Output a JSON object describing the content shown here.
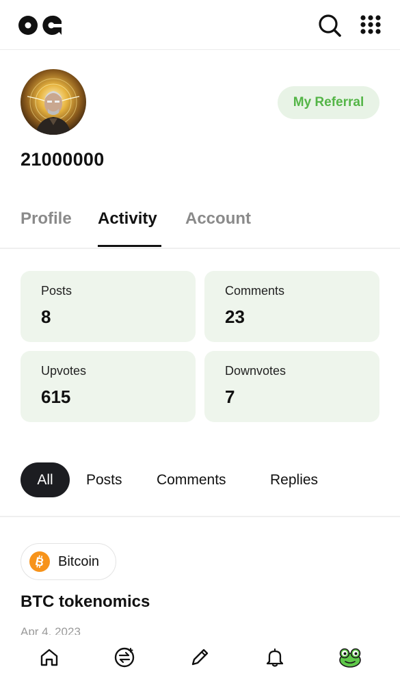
{
  "header": {
    "logo_icon": "og-logo-icon",
    "search_icon": "search-icon",
    "menu_icon": "grid-menu-icon"
  },
  "profile": {
    "avatar_icon": "avatar",
    "referral_label": "My Referral",
    "username": "21000000"
  },
  "tabs": [
    {
      "label": "Profile",
      "active": false
    },
    {
      "label": "Activity",
      "active": true
    },
    {
      "label": "Account",
      "active": false
    }
  ],
  "stats": [
    {
      "label": "Posts",
      "value": "8"
    },
    {
      "label": "Comments",
      "value": "23"
    },
    {
      "label": "Upvotes",
      "value": "615"
    },
    {
      "label": "Downvotes",
      "value": "7"
    }
  ],
  "filters": [
    {
      "label": "All",
      "active": true
    },
    {
      "label": "Posts",
      "active": false
    },
    {
      "label": "Comments",
      "active": false
    },
    {
      "label": "Replies",
      "active": false
    }
  ],
  "post": {
    "community": "Bitcoin",
    "community_icon": "bitcoin-icon",
    "title": "BTC tokenomics",
    "date": "Apr 4, 2023"
  },
  "bottom_nav": [
    {
      "icon": "home-icon"
    },
    {
      "icon": "swap-icon"
    },
    {
      "icon": "pencil-icon"
    },
    {
      "icon": "bell-icon"
    },
    {
      "icon": "frog-avatar-icon"
    }
  ],
  "colors": {
    "accent_green": "#54b547",
    "referral_bg": "#e8f3e6",
    "stat_card_bg": "#eef5ec",
    "chip_active_bg": "#1c1d21",
    "bitcoin_orange": "#f7931a",
    "frog_green": "#5fc84a"
  }
}
